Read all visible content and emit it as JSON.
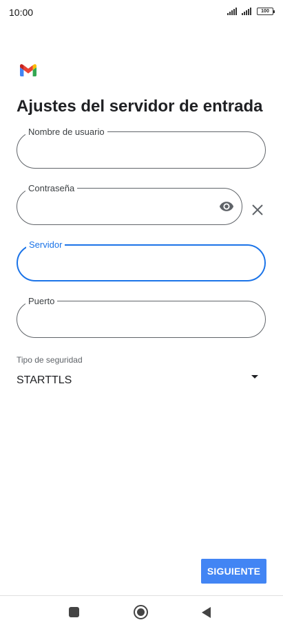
{
  "status_bar": {
    "time": "10:00",
    "battery_level": "100",
    "icons": [
      "signal-icon",
      "signal-icon",
      "battery-icon"
    ]
  },
  "app": {
    "logo_icon": "gmail-logo-icon",
    "title": "Ajustes del servidor de entrada"
  },
  "form": {
    "username": {
      "label": "Nombre de usuario",
      "value": ""
    },
    "password": {
      "label": "Contraseña",
      "value": "",
      "visibility_icon": "eye-icon",
      "clear_icon": "close-icon"
    },
    "server": {
      "label": "Servidor",
      "value": "",
      "focused": true
    },
    "port": {
      "label": "Puerto",
      "value": ""
    },
    "security": {
      "label": "Tipo de seguridad",
      "value": "STARTTLS",
      "icon": "dropdown-arrow-icon"
    }
  },
  "actions": {
    "next_label": "SIGUIENTE"
  },
  "navigation": {
    "icons": [
      "recent-apps-icon",
      "home-icon",
      "back-icon"
    ]
  },
  "colors": {
    "accent": "#1a73e8",
    "button": "#4285f4",
    "outline": "#5f6368",
    "background": "#ffffff"
  }
}
